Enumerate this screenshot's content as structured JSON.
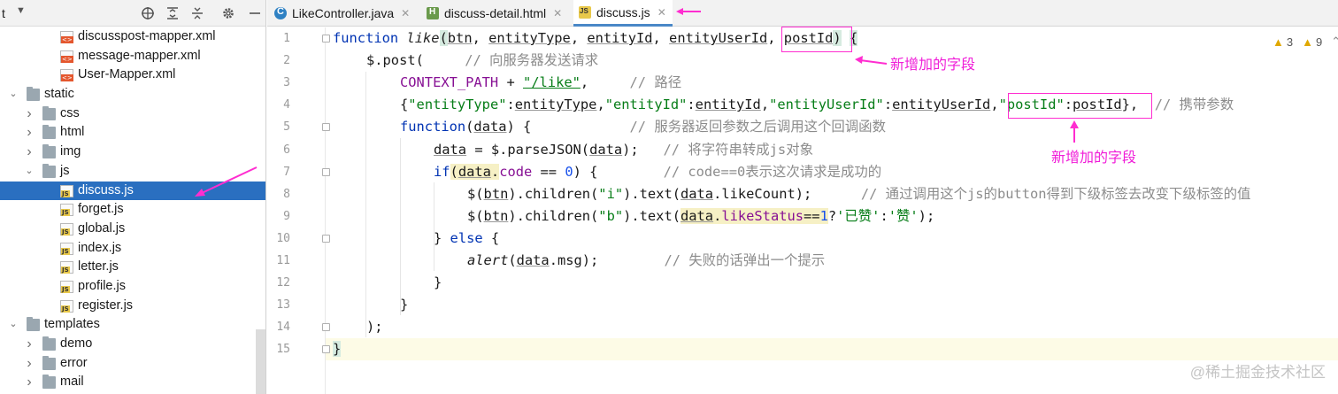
{
  "project_panel": {
    "toolbar_label": "t",
    "tree": [
      {
        "label": "discusspost-mapper.xml",
        "type": "xml",
        "indent": 2
      },
      {
        "label": "message-mapper.xml",
        "type": "xml",
        "indent": 2
      },
      {
        "label": "User-Mapper.xml",
        "type": "xml",
        "indent": 2
      },
      {
        "label": "static",
        "type": "folder",
        "indent": 0,
        "expanded": true
      },
      {
        "label": "css",
        "type": "folder",
        "indent": 1,
        "expanded": false
      },
      {
        "label": "html",
        "type": "folder",
        "indent": 1,
        "expanded": false
      },
      {
        "label": "img",
        "type": "folder",
        "indent": 1,
        "expanded": false
      },
      {
        "label": "js",
        "type": "folder",
        "indent": 1,
        "expanded": true
      },
      {
        "label": "discuss.js",
        "type": "js",
        "indent": 2,
        "selected": true
      },
      {
        "label": "forget.js",
        "type": "js",
        "indent": 2
      },
      {
        "label": "global.js",
        "type": "js",
        "indent": 2
      },
      {
        "label": "index.js",
        "type": "js",
        "indent": 2
      },
      {
        "label": "letter.js",
        "type": "js",
        "indent": 2
      },
      {
        "label": "profile.js",
        "type": "js",
        "indent": 2
      },
      {
        "label": "register.js",
        "type": "js",
        "indent": 2
      },
      {
        "label": "templates",
        "type": "folder",
        "indent": 0,
        "expanded": true
      },
      {
        "label": "demo",
        "type": "folder",
        "indent": 1,
        "expanded": false
      },
      {
        "label": "error",
        "type": "folder",
        "indent": 1,
        "expanded": false
      },
      {
        "label": "mail",
        "type": "folder",
        "indent": 1,
        "expanded": false
      }
    ]
  },
  "tabs": [
    {
      "label": "LikeController.java",
      "icon": "java-class-icon",
      "active": false
    },
    {
      "label": "discuss-detail.html",
      "icon": "html-file-icon",
      "active": false
    },
    {
      "label": "discuss.js",
      "icon": "js-file-icon",
      "active": true
    }
  ],
  "inspections": {
    "warnings": "3",
    "weak_warnings": "9"
  },
  "line_numbers": [
    "1",
    "2",
    "3",
    "4",
    "5",
    "6",
    "7",
    "8",
    "9",
    "10",
    "11",
    "12",
    "13",
    "14",
    "15"
  ],
  "code": {
    "l1": {
      "kw": "function",
      "name": "like",
      "open": "(",
      "p1": "btn",
      "p2": "entityType",
      "p3": "entityId",
      "p4": "entityUserId",
      "p5": "postId",
      "close": ")",
      "brace": "{",
      "sep": ", "
    },
    "l2": {
      "text": "$.post(",
      "comment": "// 向服务器发送请求"
    },
    "l3": {
      "ctx": "CONTEXT_PATH",
      "plus": " + ",
      "url": "\"/like\"",
      "comma": ",",
      "comment": "// 路径"
    },
    "l4": {
      "ob": "{",
      "k1": "\"entityType\"",
      "v1": "entityType",
      "k2": "\"entityId\"",
      "v2": "entityId",
      "k3": "\"entityUserId\"",
      "v3": "entityUserId",
      "k4": "\"postId\"",
      "v4": "postId",
      "colon": ":",
      "comma": ",",
      "cb": "},",
      "comment": "// 携带参数"
    },
    "l5": {
      "kw": "function",
      "open": "(",
      "param": "data",
      "close": ") {",
      "comment": "// 服务器返回参数之后调用这个回调函数"
    },
    "l6": {
      "var": "data",
      "mid": " = $.parseJSON(",
      "arg": "data",
      "end": ");",
      "comment": "// 将字符串转成js对象"
    },
    "l7": {
      "kw": "if",
      "open": "(",
      "obj": "data",
      "dot": ".",
      "prop": "code",
      "op": " == ",
      "num": "0",
      "close": ") {",
      "comment": "// code==0表示这次请求是成功的"
    },
    "l8": {
      "a": "$(",
      "btn": "btn",
      "b": ").children(",
      "s": "\"i\"",
      "c": ").text(",
      "obj": "data",
      "d": ".likeCount);",
      "comment": "// 通过调用这个js的button得到下级标签去改变下级标签的值"
    },
    "l9": {
      "a": "$(",
      "btn": "btn",
      "b": ").children(",
      "s": "\"b\"",
      "c": ").text(",
      "obj": "data",
      "dot": ".",
      "prop": "likeStatus",
      "op": "==",
      "num": "1",
      "q": "?",
      "s1": "'已赞'",
      "colon": ":",
      "s2": "'赞'",
      "end": ");"
    },
    "l10": {
      "text": "} ",
      "kw": "else",
      "rest": " {"
    },
    "l11": {
      "fn": "alert",
      "open": "(",
      "obj": "data",
      "rest": ".msg);",
      "comment": "// 失败的话弹出一个提示"
    },
    "l12": {
      "text": "}"
    },
    "l13": {
      "text": "}"
    },
    "l14": {
      "text": ");"
    },
    "l15": {
      "text": "}"
    }
  },
  "annotations": {
    "new_field_1": "新增加的字段",
    "new_field_2": "新增加的字段"
  },
  "watermark": "@稀土掘金技术社区",
  "colors": {
    "annotation": "#ff2dd0",
    "selection": "#2a6fc0",
    "keyword": "#0033b3",
    "string": "#067d17",
    "comment": "#8c8c8c"
  }
}
